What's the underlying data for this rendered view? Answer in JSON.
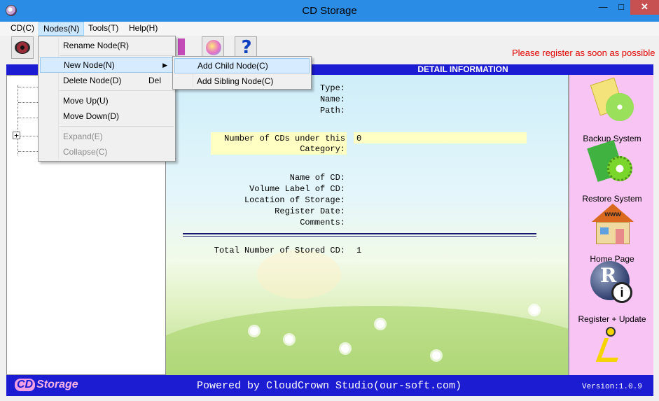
{
  "window": {
    "title": "CD Storage",
    "min_glyph": "—",
    "max_glyph": "□",
    "close_glyph": "✕"
  },
  "menubar": {
    "items": [
      "CD(C)",
      "Nodes(N)",
      "Tools(T)",
      "Help(H)"
    ]
  },
  "register_note": "Please register as soon as possible",
  "detail_header": "DETAIL INFORMATION",
  "nodes_menu": {
    "rename": "Rename Node(R)",
    "new_node": "New Node(N)",
    "delete": "Delete Node(D)",
    "delete_shortcut": "Del",
    "move_up": "Move Up(U)",
    "move_down": "Move Down(D)",
    "expand": "Expand(E)",
    "collapse": "Collapse(C)"
  },
  "new_node_submenu": {
    "add_child": "Add Child Node(C)",
    "add_sibling": "Add Sibling Node(C)"
  },
  "tree": {
    "expander": "+"
  },
  "detail": {
    "type_label": "Type:",
    "name_label": "Name:",
    "path_label": "Path:",
    "num_cds_label_1": "Number of CDs under this",
    "num_cds_label_2": "Category:",
    "num_cds_value": "0",
    "cd_name_label": "Name of CD:",
    "volume_label": "Volume Label of CD:",
    "location_label": "Location of Storage:",
    "register_date_label": "Register Date:",
    "comments_label": "Comments:",
    "total_label": "Total Number of Stored CD:",
    "total_value": "1"
  },
  "side_panel": {
    "backup": "Backup System",
    "restore": "Restore System",
    "home": "Home Page",
    "register": "Register + Update",
    "home_badge": "www"
  },
  "footer": {
    "logo_cd": "CD",
    "logo_text": "Storage",
    "powered": "Powered by CloudCrown Studio(our-soft.com)",
    "version": "Version:1.0.9"
  },
  "colors": {
    "band": "#1c1cd2",
    "side_panel": "#f8c4f3",
    "highlight": "#ffffc4",
    "register_note": "#e00000"
  }
}
